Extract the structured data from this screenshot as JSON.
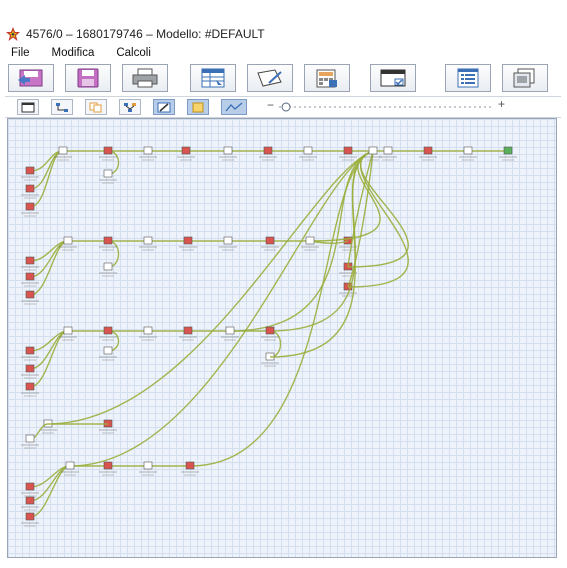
{
  "window": {
    "title": "4576/0 –   1680179746 – Modello: #DEFAULT",
    "app_icon": "star-logo-icon"
  },
  "menu": {
    "items": [
      "File",
      "Modifica",
      "Calcoli"
    ]
  },
  "toolbar1": {
    "buttons": [
      {
        "name": "open-model-button",
        "icon": "folder-arrow-icon"
      },
      {
        "name": "save-model-button",
        "icon": "floppy-disk-icon"
      },
      {
        "name": "print-button",
        "icon": "printer-icon"
      },
      {
        "name": "table-button",
        "icon": "table-grid-icon"
      },
      {
        "name": "edit-button",
        "icon": "paper-pen-icon"
      },
      {
        "name": "calculator-button",
        "icon": "calculator-icon"
      },
      {
        "name": "window-check-button",
        "icon": "window-check-icon"
      },
      {
        "name": "list-view-button",
        "icon": "list-view-icon"
      },
      {
        "name": "print-preview-button",
        "icon": "print-preview-icon"
      }
    ]
  },
  "toolbar2": {
    "buttons": [
      {
        "name": "new-window-button",
        "icon": "window-icon",
        "active": false
      },
      {
        "name": "connect-button",
        "icon": "connector-icon",
        "active": false
      },
      {
        "name": "copy-button",
        "icon": "copy-icon",
        "active": false
      },
      {
        "name": "tree-button",
        "icon": "tree-icon",
        "active": false
      },
      {
        "name": "edit-link-button",
        "icon": "pencil-link-icon",
        "active": true
      },
      {
        "name": "note-button",
        "icon": "note-icon",
        "active": true
      },
      {
        "name": "zoom-fit-button",
        "icon": "zoom-fit-icon",
        "active": true
      }
    ],
    "zoom_minus": "−",
    "zoom_plus": "+",
    "zoom_level": 0.1
  },
  "colors": {
    "link": "#9aae3c",
    "canvas_bg": "#eef3fb",
    "grid": "#d3dfee",
    "node_red": "#d9534f",
    "node_yellow": "#f4e46a",
    "node_green": "#5bb05b"
  }
}
